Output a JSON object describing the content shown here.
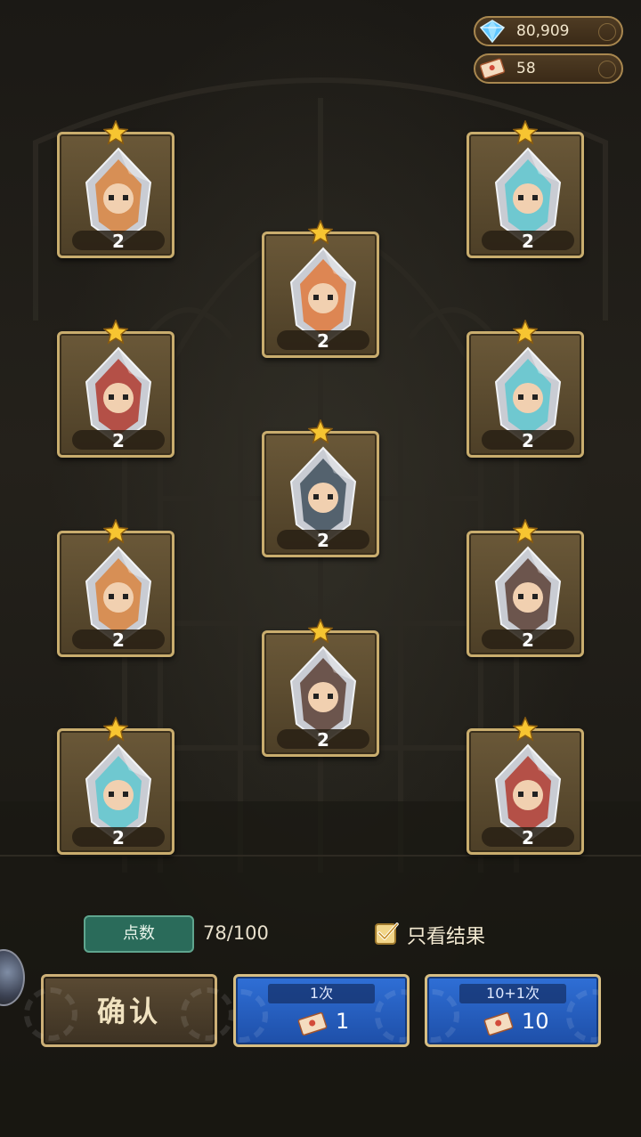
{
  "currency": {
    "gems": {
      "icon": "diamond-icon",
      "value": "80,909"
    },
    "tickets": {
      "icon": "ticket-icon",
      "value": "58"
    }
  },
  "cards": [
    {
      "character": "fox",
      "level": "2",
      "color": "#d9843e"
    },
    {
      "character": "red-hair-pilot",
      "level": "2",
      "color": "#e0793c"
    },
    {
      "character": "ice-spirit",
      "level": "2",
      "color": "#5fc7cf"
    },
    {
      "character": "bearded-dwarf",
      "level": "2",
      "color": "#b03a2e"
    },
    {
      "character": "ice-spirit",
      "level": "2",
      "color": "#5fc7cf"
    },
    {
      "character": "pirate-girl",
      "level": "2",
      "color": "#3f4f5c"
    },
    {
      "character": "fox",
      "level": "2",
      "color": "#d9843e"
    },
    {
      "character": "hat-knight",
      "level": "2",
      "color": "#5c4035"
    },
    {
      "character": "hat-knight",
      "level": "2",
      "color": "#5c4035"
    },
    {
      "character": "ice-spirit",
      "level": "2",
      "color": "#5fc7cf"
    },
    {
      "character": "bearded-dwarf",
      "level": "2",
      "color": "#b03a2e"
    }
  ],
  "points": {
    "label": "点数",
    "value": "78/100"
  },
  "result_only": {
    "label": "只看结果",
    "checked": true
  },
  "confirm_label": "确认",
  "pull_once": {
    "title": "1次",
    "cost": "1"
  },
  "pull_ten": {
    "title": "10+1次",
    "cost": "10"
  }
}
